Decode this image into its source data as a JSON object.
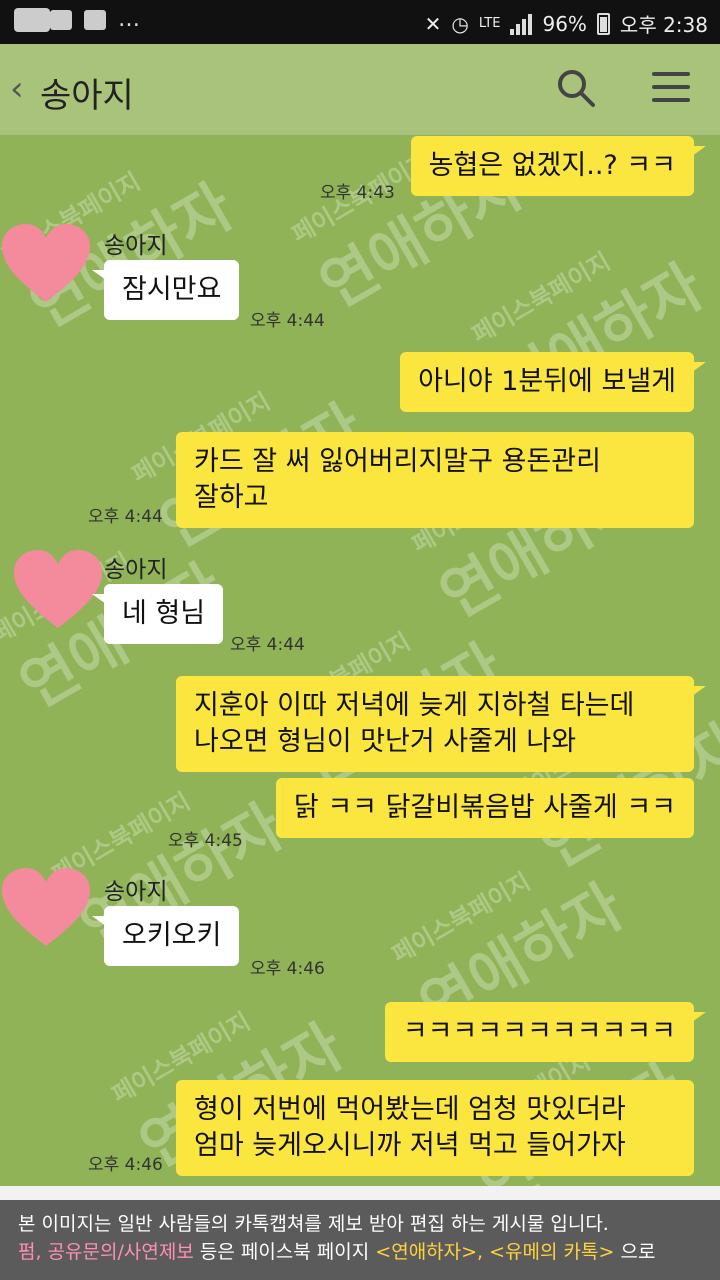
{
  "status_bar": {
    "network": "LTE",
    "battery": "96%",
    "time": "오후 2:38"
  },
  "header": {
    "title": "송아지",
    "back_icon": "chevron-left-icon",
    "search_icon": "search-icon",
    "menu_icon": "menu-icon"
  },
  "watermark": {
    "main": "연애하자",
    "sub": "페이스북페이지"
  },
  "messages": [
    {
      "from": "me",
      "lines": [
        "농협은 없겠지..? ㅋㅋ"
      ],
      "time": "오후 4:43"
    },
    {
      "from": "송아지",
      "lines": [
        "잠시만요"
      ],
      "time": "오후 4:44"
    },
    {
      "from": "me",
      "lines": [
        "아니야 1분뒤에 보낼게"
      ],
      "time": ""
    },
    {
      "from": "me",
      "lines": [
        "카드 잘 써 잃어버리지말구 용돈관리",
        "잘하고"
      ],
      "time": "오후 4:44"
    },
    {
      "from": "송아지",
      "lines": [
        "네 형님"
      ],
      "time": "오후 4:44"
    },
    {
      "from": "me",
      "lines": [
        "지훈아 이따 저녁에 늦게 지하철 타는데",
        "나오면 형님이 맛난거 사줄게 나와"
      ],
      "time": ""
    },
    {
      "from": "me",
      "lines": [
        "닭 ㅋㅋ 닭갈비볶음밥 사줄게 ㅋㅋ"
      ],
      "time": "오후 4:45"
    },
    {
      "from": "송아지",
      "lines": [
        "오키오키"
      ],
      "time": "오후 4:46"
    },
    {
      "from": "me",
      "lines": [
        "ㅋㅋㅋㅋㅋㅋㅋㅋㅋㅋㅋ"
      ],
      "time": ""
    },
    {
      "from": "me",
      "lines": [
        "형이 저번에 먹어봤는데 엄청 맛있더라",
        "엄마 늦게오시니까 저녁 먹고 들어가자"
      ],
      "time": "오후 4:46"
    }
  ],
  "caption": {
    "line1": "본 이미지는 일반 사람들의 카톡캡쳐를 제보 받아 편집 하는 게시물 입니다.",
    "line2_pink": "펌, 공유문의/사연제보",
    "line2_mid": " 등은 페이스북 페이지 ",
    "line2_yellow": "<연애하자>, <유메의 카톡>",
    "line2_end": " 으로"
  },
  "colors": {
    "chat_background": "#8fb356",
    "outgoing_bubble": "#fbe640",
    "incoming_bubble": "#ffffff",
    "avatar_heart": "#f48b9c"
  }
}
